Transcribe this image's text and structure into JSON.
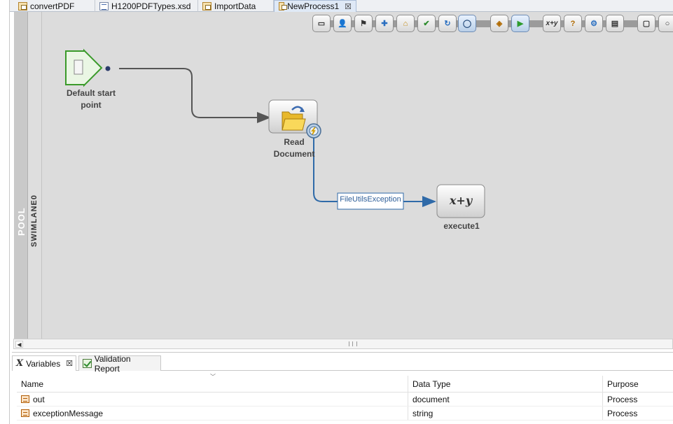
{
  "editor_tabs": [
    {
      "label": "convertPDF",
      "icon": "process-file-icon",
      "active": false
    },
    {
      "label": "H1200PDFTypes.xsd",
      "icon": "xsd-file-icon",
      "active": false
    },
    {
      "label": "ImportData",
      "icon": "process-file-icon",
      "active": false
    },
    {
      "label": "NewProcess1",
      "icon": "process-file-icon",
      "active": true,
      "close": "☒"
    }
  ],
  "diagram": {
    "pool_label": "POOL",
    "swimlane_label": "SWIMLANE0",
    "start_label_line1": "Default start",
    "start_label_line2": "point",
    "read_label_line1": "Read",
    "read_label_line2": "Document",
    "exception_label": "FileUtilsException",
    "execute_symbol": "x+y",
    "execute_label": "execute1"
  },
  "palette": [
    {
      "name": "new-activity-icon",
      "glyph": "▭"
    },
    {
      "name": "user-task-icon",
      "glyph": "👤"
    },
    {
      "name": "users-icon",
      "glyph": "⚑"
    },
    {
      "name": "add-icon",
      "glyph": "✚"
    },
    {
      "name": "folder-up-icon",
      "glyph": "⌂"
    },
    {
      "name": "check-task-icon",
      "glyph": "✔"
    },
    {
      "name": "subprocess-icon",
      "glyph": "↻"
    },
    {
      "name": "event-circle-icon",
      "glyph": "◯"
    },
    {
      "name": "gateway-icon",
      "glyph": "◈"
    },
    {
      "name": "play-icon",
      "glyph": "▶"
    },
    {
      "name": "expression-icon",
      "glyph": "x+y"
    },
    {
      "name": "decision-icon",
      "glyph": "?"
    },
    {
      "name": "service-icon",
      "glyph": "⚙"
    },
    {
      "name": "data-icon",
      "glyph": "▤"
    },
    {
      "name": "rect-shape-icon",
      "glyph": "▢"
    },
    {
      "name": "circle-shape-icon",
      "glyph": "○"
    }
  ],
  "bottom_tabs": [
    {
      "label": "Variables",
      "close": "☒"
    },
    {
      "label": "Validation Report"
    }
  ],
  "variables_table": {
    "columns": [
      "Name",
      "Data Type",
      "Purpose"
    ],
    "rows": [
      {
        "name": "out",
        "type": "document",
        "purpose": "Process"
      },
      {
        "name": "exceptionMessage",
        "type": "string",
        "purpose": "Process"
      }
    ]
  },
  "colors": {
    "canvas": "#dcdcdc",
    "connector": "#555555",
    "exception_connector": "#2f6aa8",
    "start_event": "#3a9a2a"
  }
}
